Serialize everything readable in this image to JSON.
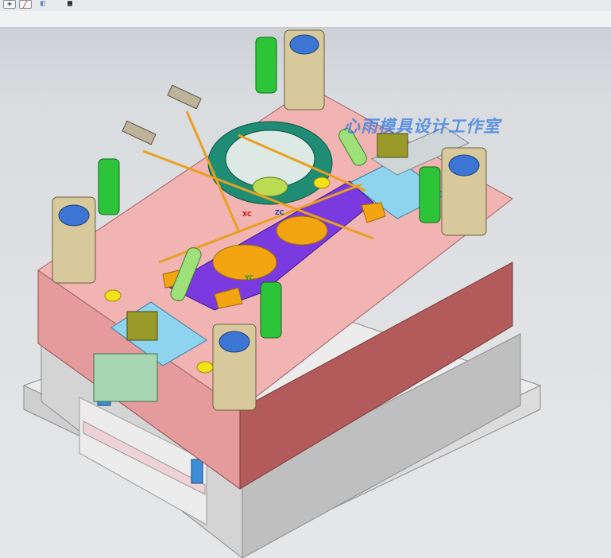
{
  "toolbar": {
    "buttons": [
      {
        "name": "plus",
        "glyph": "+"
      },
      {
        "name": "line",
        "glyph": "╱"
      },
      {
        "name": "view",
        "glyph": "◧"
      },
      {
        "name": "grid",
        "glyph": "▦"
      }
    ]
  },
  "watermark": "心雨模具设计工作室",
  "axes": {
    "x": "XC",
    "y": "YC",
    "z": "ZC"
  },
  "colors": {
    "plate_pink": "#f2b3b3",
    "plate_red_side": "#b35a5a",
    "plate_grey": "#d7d7d7",
    "slider_purple": "#7a3ae0",
    "bolt_green": "#2ec43a",
    "ring_teal": "#1f8d73",
    "insert_orange": "#f2a510",
    "bushing_tan": "#d7c99b",
    "accent_blue": "#3a7ee0"
  }
}
